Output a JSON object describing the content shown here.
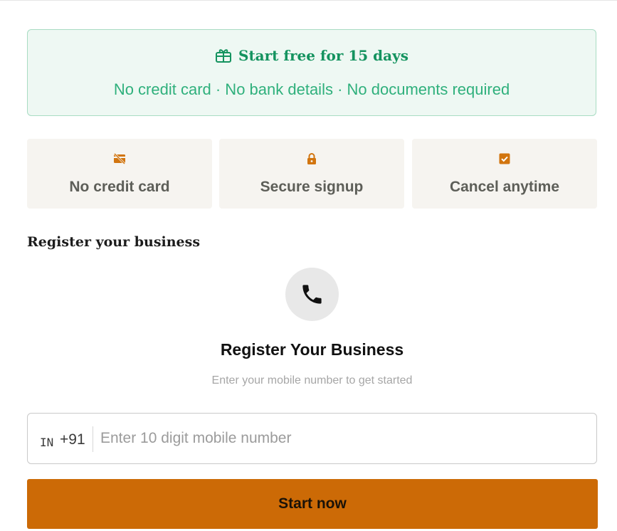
{
  "promo": {
    "icon": "gift-icon",
    "title": "Start free for 15 days",
    "subtitle": "No credit card · No bank details · No documents required",
    "color": "#14935f"
  },
  "features": [
    {
      "icon": "no-card-icon",
      "label": "No credit card"
    },
    {
      "icon": "lock-icon",
      "label": "Secure signup"
    },
    {
      "icon": "checkbox-icon",
      "label": "Cancel anytime"
    }
  ],
  "section_heading": "Register your business",
  "form": {
    "icon": "phone-icon",
    "title": "Register Your Business",
    "subtitle": "Enter your mobile number to get started",
    "country_flag": "IN",
    "country_code": "+91",
    "mobile_placeholder": "Enter 10 digit mobile number",
    "mobile_value": "",
    "submit_label": "Start now"
  },
  "colors": {
    "accent": "#cc6a06",
    "promo_green": "#14935f",
    "feature_icon": "#d2750f"
  }
}
